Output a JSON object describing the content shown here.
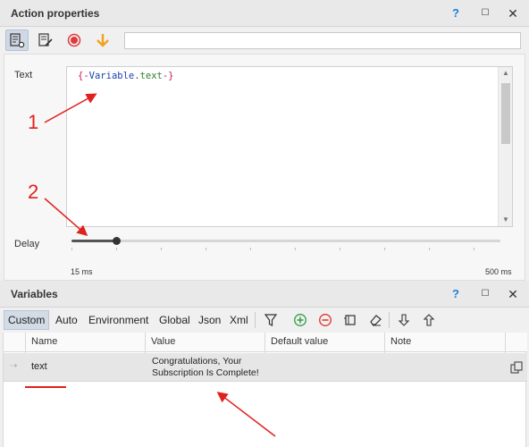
{
  "action_panel": {
    "title": "Action properties",
    "help": "?",
    "maximize": "☐",
    "close": "✕"
  },
  "toolbar": {
    "input_value": ""
  },
  "props": {
    "text_label": "Text",
    "text_open": "{-",
    "text_var": "Variable",
    "text_dot": ".",
    "text_name": "text",
    "text_close": "-}",
    "delay_label": "Delay",
    "delay_min": "15 ms",
    "delay_max": "500 ms",
    "delay_value_ms": 50
  },
  "annotations": {
    "one": "1",
    "two": "2"
  },
  "variables_panel": {
    "title": "Variables",
    "help": "?",
    "maximize": "☐",
    "close": "✕",
    "tabs": [
      "Custom",
      "Auto",
      "Environment",
      "Global",
      "Json",
      "Xml"
    ],
    "columns": [
      "Name",
      "Value",
      "Default value",
      "Note"
    ],
    "rows": [
      {
        "name": "text",
        "value_line1": "Congratulations, Your",
        "value_line2": "Subscription Is Complete!",
        "default": "",
        "note": ""
      }
    ]
  },
  "colors": {
    "accent": "#1e7fd9",
    "annotation_red": "#e0211d",
    "record": "#e03a3a",
    "down_arrow": "#f0a21c",
    "add": "#2e9c46",
    "remove": "#d9342b"
  }
}
